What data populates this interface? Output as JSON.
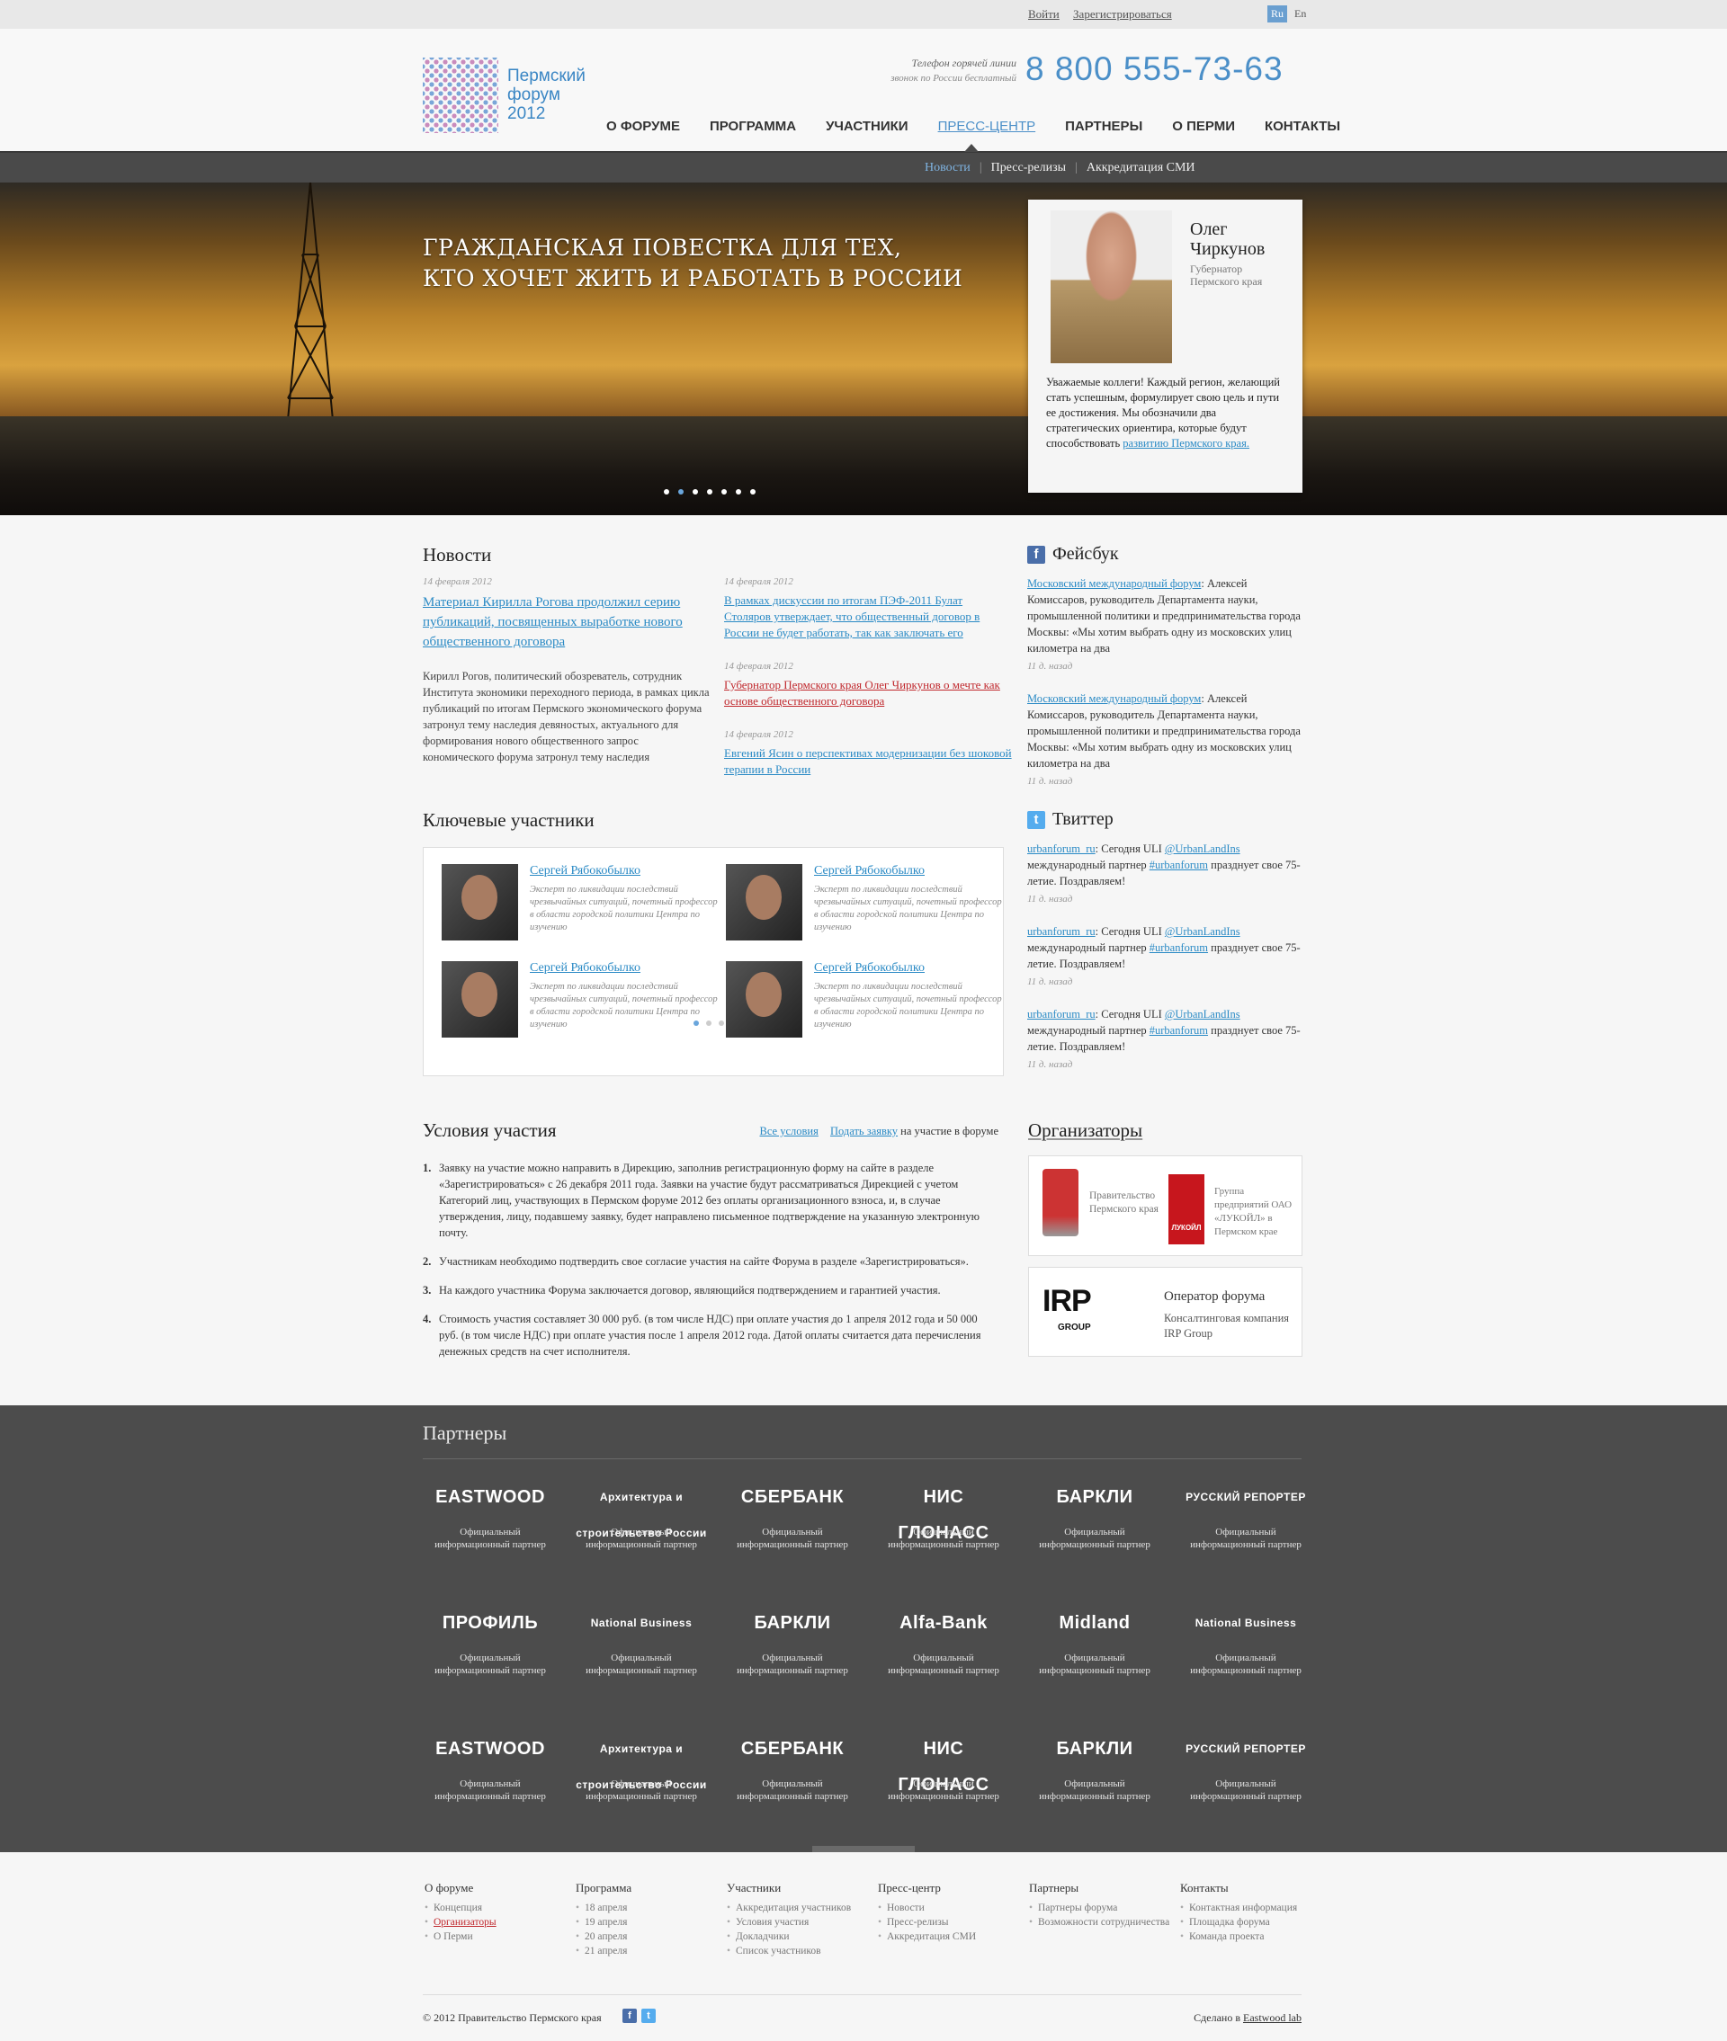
{
  "topbar": {
    "login": "Войти",
    "register": "Зарегистрироваться",
    "lang_ru": "Ru",
    "lang_en": "En"
  },
  "logo": {
    "line1": "Пермский",
    "line2": "форум",
    "line3": "2012"
  },
  "hotline": {
    "label": "Телефон горячей линии",
    "sub": "звонок по России бесплатный",
    "phone": "8 800 555-73-63"
  },
  "nav": [
    "О ФОРУМЕ",
    "ПРОГРАММА",
    "УЧАСТНИКИ",
    "ПРЕСС-ЦЕНТР",
    "ПАРТНЕРЫ",
    "О ПЕРМИ",
    "КОНТАКТЫ"
  ],
  "subnav": [
    "Новости",
    "Пресс-релизы",
    "Аккредитация СМИ"
  ],
  "hero": {
    "line1": "ГРАЖДАНСКАЯ ПОВЕСТКА ДЛЯ ТЕХ,",
    "line2": "КТО ХОЧЕТ ЖИТЬ И РАБОТАТЬ В РОССИИ",
    "slide_count": 7,
    "active_slide": 1
  },
  "quote": {
    "name1": "Олег",
    "name2": "Чиркунов",
    "role1": "Губернатор",
    "role2": "Пермского края",
    "text": "Уважаемые коллеги! Каждый регион, желающий стать успешным, формулирует свою цель и пути ее достижения. Мы обозначили два стратегических ориентира, которые будут способствовать ",
    "link": "развитию Пермского края."
  },
  "news": {
    "title": "Новости",
    "lead": {
      "date": "14 февраля 2012",
      "headline": "Материал Кирилла Рогова продолжил серию публикаций, посвященных выработке нового общественного договора",
      "body": "Кирилл Рогов,  политический обозреватель, сотрудник Института экономики переходного периода, в рамках цикла публикаций по итогам Пермского экономического форума затронул тему наследия девяностых, актуального для формирования нового общественного запрос кономического форума затронул тему наследия"
    },
    "items": [
      {
        "date": "14 февраля 2012",
        "text": "В рамках дискуссии по итогам ПЭФ-2011 Булат Столяров утверждает, что общественный договор в России не будет работать, так как заключать его"
      },
      {
        "date": "14 февраля 2012",
        "text": "Губернатор Пермского края Олег Чиркунов о мечте как основе общественного договора"
      },
      {
        "date": "14 февраля 2012",
        "text": "Евгений Ясин о перспективах модернизации без шоковой терапии в России"
      }
    ]
  },
  "facebook": {
    "title": "Фейсбук",
    "posts": [
      {
        "link": "Московский международный форум",
        "text": ": Алексей Комиссаров, руководитель Департамента науки, промышленной политики и предпринимательства города Москвы: «Мы хотим выбрать одну из московских улиц километра на два",
        "ago": "11 д. назад"
      },
      {
        "link": "Московский международный форум",
        "text": ": Алексей Комиссаров, руководитель Департамента науки, промышленной политики и предпринимательства города Москвы: «Мы хотим выбрать одну из московских улиц километра на два",
        "ago": "11 д. назад"
      }
    ]
  },
  "twitter": {
    "title": "Твиттер",
    "posts": [
      {
        "user": "urbanforum_ru",
        "t1": ": Сегодня ULI ",
        "mention": "@UrbanLandIns",
        "t2": " международный партнер ",
        "tag": "#urbanforum",
        "t3": " празднует свое 75-летие. Поздравляем!",
        "ago": "11 д. назад"
      },
      {
        "user": "urbanforum_ru",
        "t1": ": Сегодня ULI ",
        "mention": "@UrbanLandIns",
        "t2": " международный партнер ",
        "tag": "#urbanforum",
        "t3": " празднует свое 75-летие. Поздравляем!",
        "ago": "11 д. назад"
      },
      {
        "user": "urbanforum_ru",
        "t1": ": Сегодня ULI ",
        "mention": "@UrbanLandIns",
        "t2": " международный партнер ",
        "tag": "#urbanforum",
        "t3": " празднует свое 75-летие. Поздравляем!",
        "ago": "11 д. назад"
      }
    ]
  },
  "key_participants": {
    "title": "Ключевые участники",
    "people": [
      {
        "name": "Сергей Рябокобылко",
        "desc": "Эксперт по ликвидации последствий чрезвычайных ситуаций, почетный профессор в области городской политики Центра по изучению"
      },
      {
        "name": "Сергей Рябокобылко",
        "desc": "Эксперт по ликвидации последствий чрезвычайных ситуаций, почетный профессор в области городской политики Центра по изучению"
      },
      {
        "name": "Сергей Рябокобылко",
        "desc": "Эксперт по ликвидации последствий чрезвычайных ситуаций, почетный профессор в области городской политики Центра по изучению"
      },
      {
        "name": "Сергей Рябокобылко",
        "desc": "Эксперт по ликвидации последствий чрезвычайных ситуаций, почетный профессор в области городской политики Центра по изучению"
      }
    ]
  },
  "conditions": {
    "title": "Условия участия",
    "all_link": "Все условия",
    "apply_link": "Подать заявку",
    "apply_suffix": " на участие в форуме",
    "items": [
      "Заявку на участие можно направить в Дирекцию, заполнив регистрационную форму на сайте в разделе «Зарегистрироваться» с 26 декабря 2011 года. Заявки на участие будут рассматриваться Дирекцией с учетом Категорий лиц, участвующих в Пермском форуме 2012 без оплаты организационного взноса, и, в случае утверждения, лицу, подавшему заявку, будет направлено письменное подтверждение на указанную электронную почту.",
      "Участникам необходимо подтвердить свое согласие участия на сайте Форума в разделе «Зарегистрироваться».",
      "На каждого участника Форума заключается договор, являющийся подтверждением и гарантией участия.",
      "Стоимость участия составляет 30 000 руб. (в том числе НДС) при оплате участия до 1 апреля 2012 года и 50 000 руб. (в том числе НДС) при оплате участия после 1 апреля 2012 года. Датой оплаты считается дата перечисления денежных средств на счет исполнителя."
    ]
  },
  "organizers": {
    "title": "Организаторы",
    "gov": "Правительство Пермского края",
    "lukoil_logo": "ЛУКОЙЛ",
    "lukoil": "Группа предприятий ОАО «ЛУКОЙЛ» в Пермском крае",
    "irp_logo": "IRP",
    "irp_sub": "GROUP",
    "operator": "Оператор форума",
    "operator_desc": "Консалтинговая компания IRP Group"
  },
  "partners": {
    "title": "Партнеры",
    "caption": "Официальный информационный партнер",
    "rows": [
      [
        "EASTWOOD",
        "Архитектура и строительство России",
        "СБЕРБАНК",
        "НИС ГЛОНАСС",
        "БАРКЛИ",
        "РУССКИЙ РЕПОРТЕР"
      ],
      [
        "ПРОФИЛЬ",
        "National Business",
        "БАРКЛИ",
        "Alfa-Bank",
        "Midland",
        "National Business"
      ],
      [
        "EASTWOOD",
        "Архитектура и строительство России",
        "СБЕРБАНК",
        "НИС ГЛОНАСС",
        "БАРКЛИ",
        "РУССКИЙ РЕПОРТЕР"
      ]
    ]
  },
  "footer": {
    "cols": [
      {
        "head": "О форуме",
        "items": [
          "Концепция",
          "Организаторы",
          "О Перми"
        ]
      },
      {
        "head": "Программа",
        "items": [
          "18 апреля",
          "19 апреля",
          "20 апреля",
          "21 апреля"
        ]
      },
      {
        "head": "Участники",
        "items": [
          "Аккредитация участников",
          "Условия участия",
          "Докладчики",
          "Список участников"
        ]
      },
      {
        "head": "Пресс-центр",
        "items": [
          "Новости",
          "Пресс-релизы",
          "Аккредитация СМИ"
        ]
      },
      {
        "head": "Партнеры",
        "items": [
          "Партнеры форума",
          "Возможности сотрудничества"
        ]
      },
      {
        "head": "Контакты",
        "items": [
          "Контактная информация",
          "Площадка форума",
          "Команда проекта"
        ]
      }
    ],
    "copyright": "© 2012 Правительство Пермского края",
    "made_prefix": "Сделано в ",
    "made_link": "Eastwood lab"
  },
  "colors": {
    "accent": "#4b8fc8",
    "link": "#2a8ac5",
    "red": "#c0282d",
    "dark": "#4c4c4c"
  }
}
